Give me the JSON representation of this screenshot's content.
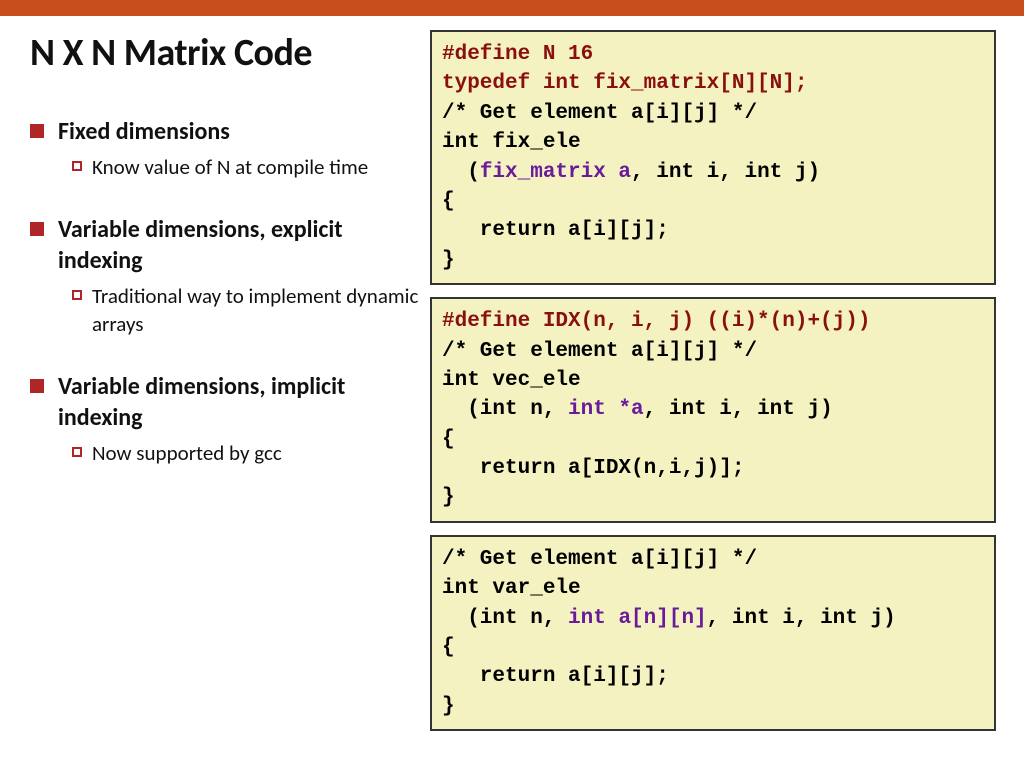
{
  "title": "N X N Matrix Code",
  "bullets": [
    {
      "head": "Fixed dimensions",
      "sub": "Know value of N at compile time"
    },
    {
      "head": "Variable dimensions, explicit indexing",
      "sub": "Traditional way to implement dynamic arrays"
    },
    {
      "head": "Variable dimensions, implicit indexing",
      "sub": "Now supported by gcc"
    }
  ],
  "code1": {
    "l1a": "#define N 16",
    "l2a": "typedef int fix_matrix[N][N];",
    "l3": "/* Get element a[i][j] */",
    "l4": "int fix_ele",
    "l5a": "  (",
    "l5b": "fix_matrix a",
    "l5c": ", int i, int j)",
    "l6": "{",
    "l7": "   return a[i][j];",
    "l8": "}"
  },
  "code2": {
    "l1a": "#define IDX(n, i, j) ((i)*(n)+(j))",
    "l2": "/* Get element a[i][j] */",
    "l3": "int vec_ele",
    "l4a": "  (int n, ",
    "l4b": "int *a",
    "l4c": ", int i, int j)",
    "l5": "{",
    "l6": "   return a[IDX(n,i,j)];",
    "l7": "}"
  },
  "code3": {
    "l1": "/* Get element a[i][j] */",
    "l2": "int var_ele",
    "l3a": "  (int n, ",
    "l3b": "int a[n][n]",
    "l3c": ", int i, int j)",
    "l4": "{",
    "l5": "   return a[i][j];",
    "l6": "}"
  }
}
